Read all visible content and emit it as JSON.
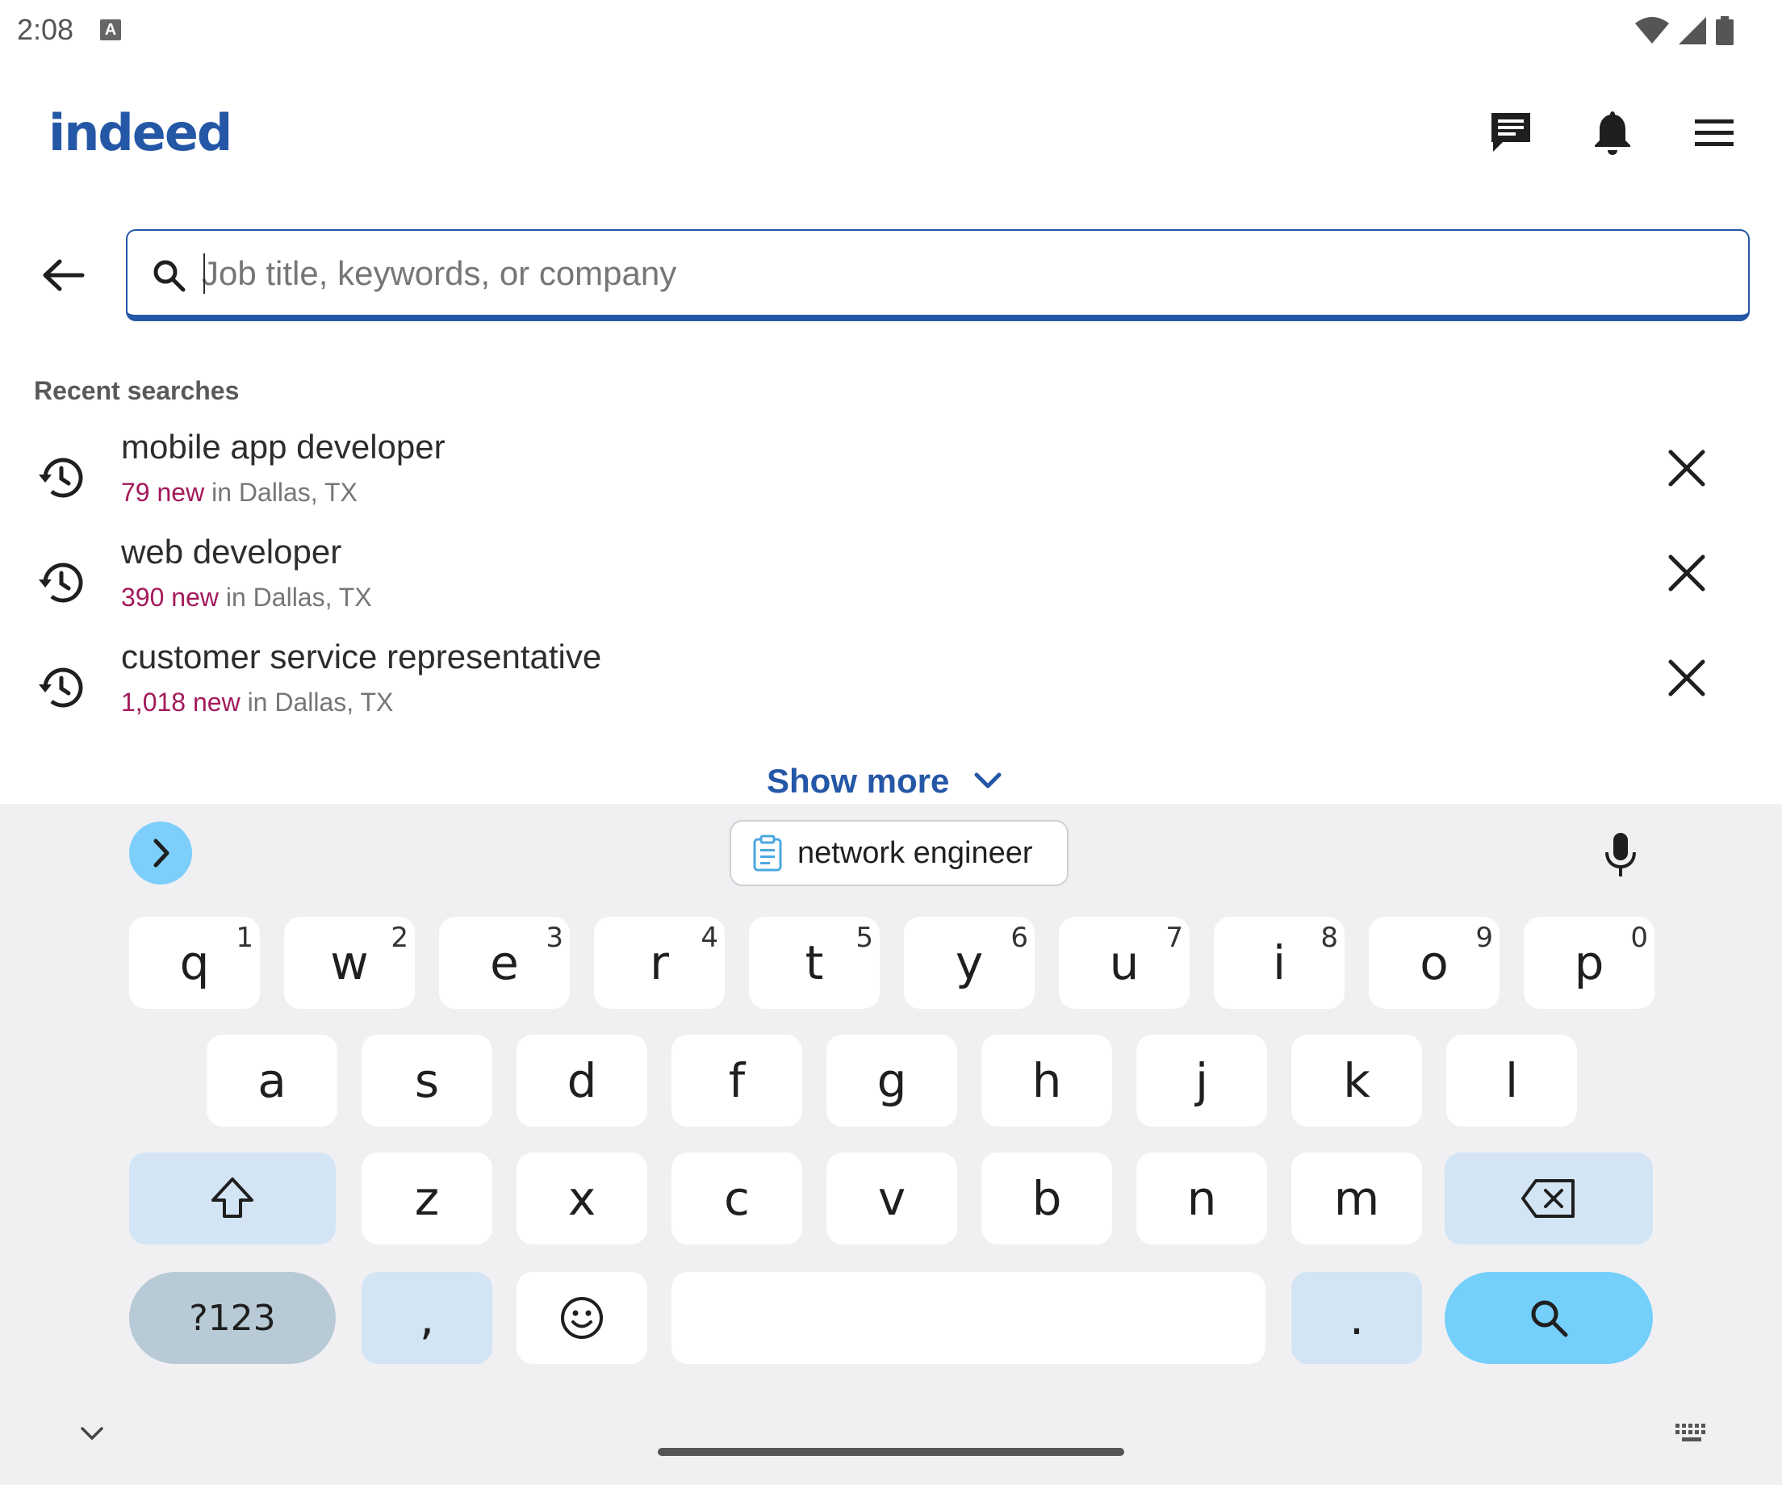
{
  "status_bar": {
    "time": "2:08",
    "badge": "A"
  },
  "header": {
    "logo_text": "indeed",
    "icons": [
      "messages-icon",
      "notifications-bell-icon",
      "menu-icon"
    ]
  },
  "search": {
    "placeholder": "Job title, keywords, or company",
    "value": ""
  },
  "recent": {
    "title": "Recent searches",
    "items": [
      {
        "query": "mobile app developer",
        "new_count": "79 new",
        "location": "in Dallas, TX"
      },
      {
        "query": "web developer",
        "new_count": "390 new",
        "location": "in Dallas, TX"
      },
      {
        "query": "customer service representative",
        "new_count": "1,018 new",
        "location": "in Dallas, TX"
      }
    ],
    "show_more": "Show more"
  },
  "keyboard": {
    "suggestion": "network engineer",
    "row1": [
      "q",
      "w",
      "e",
      "r",
      "t",
      "y",
      "u",
      "i",
      "o",
      "p"
    ],
    "row1_nums": [
      "1",
      "2",
      "3",
      "4",
      "5",
      "6",
      "7",
      "8",
      "9",
      "0"
    ],
    "row2": [
      "a",
      "s",
      "d",
      "f",
      "g",
      "h",
      "j",
      "k",
      "l"
    ],
    "row3": [
      "z",
      "x",
      "c",
      "v",
      "b",
      "n",
      "m"
    ],
    "symbols_key": "?123",
    "comma_key": ",",
    "period_key": "."
  },
  "colors": {
    "brand_blue": "#2557a7",
    "new_count": "#a3195b",
    "kb_accent": "#74cffb"
  }
}
